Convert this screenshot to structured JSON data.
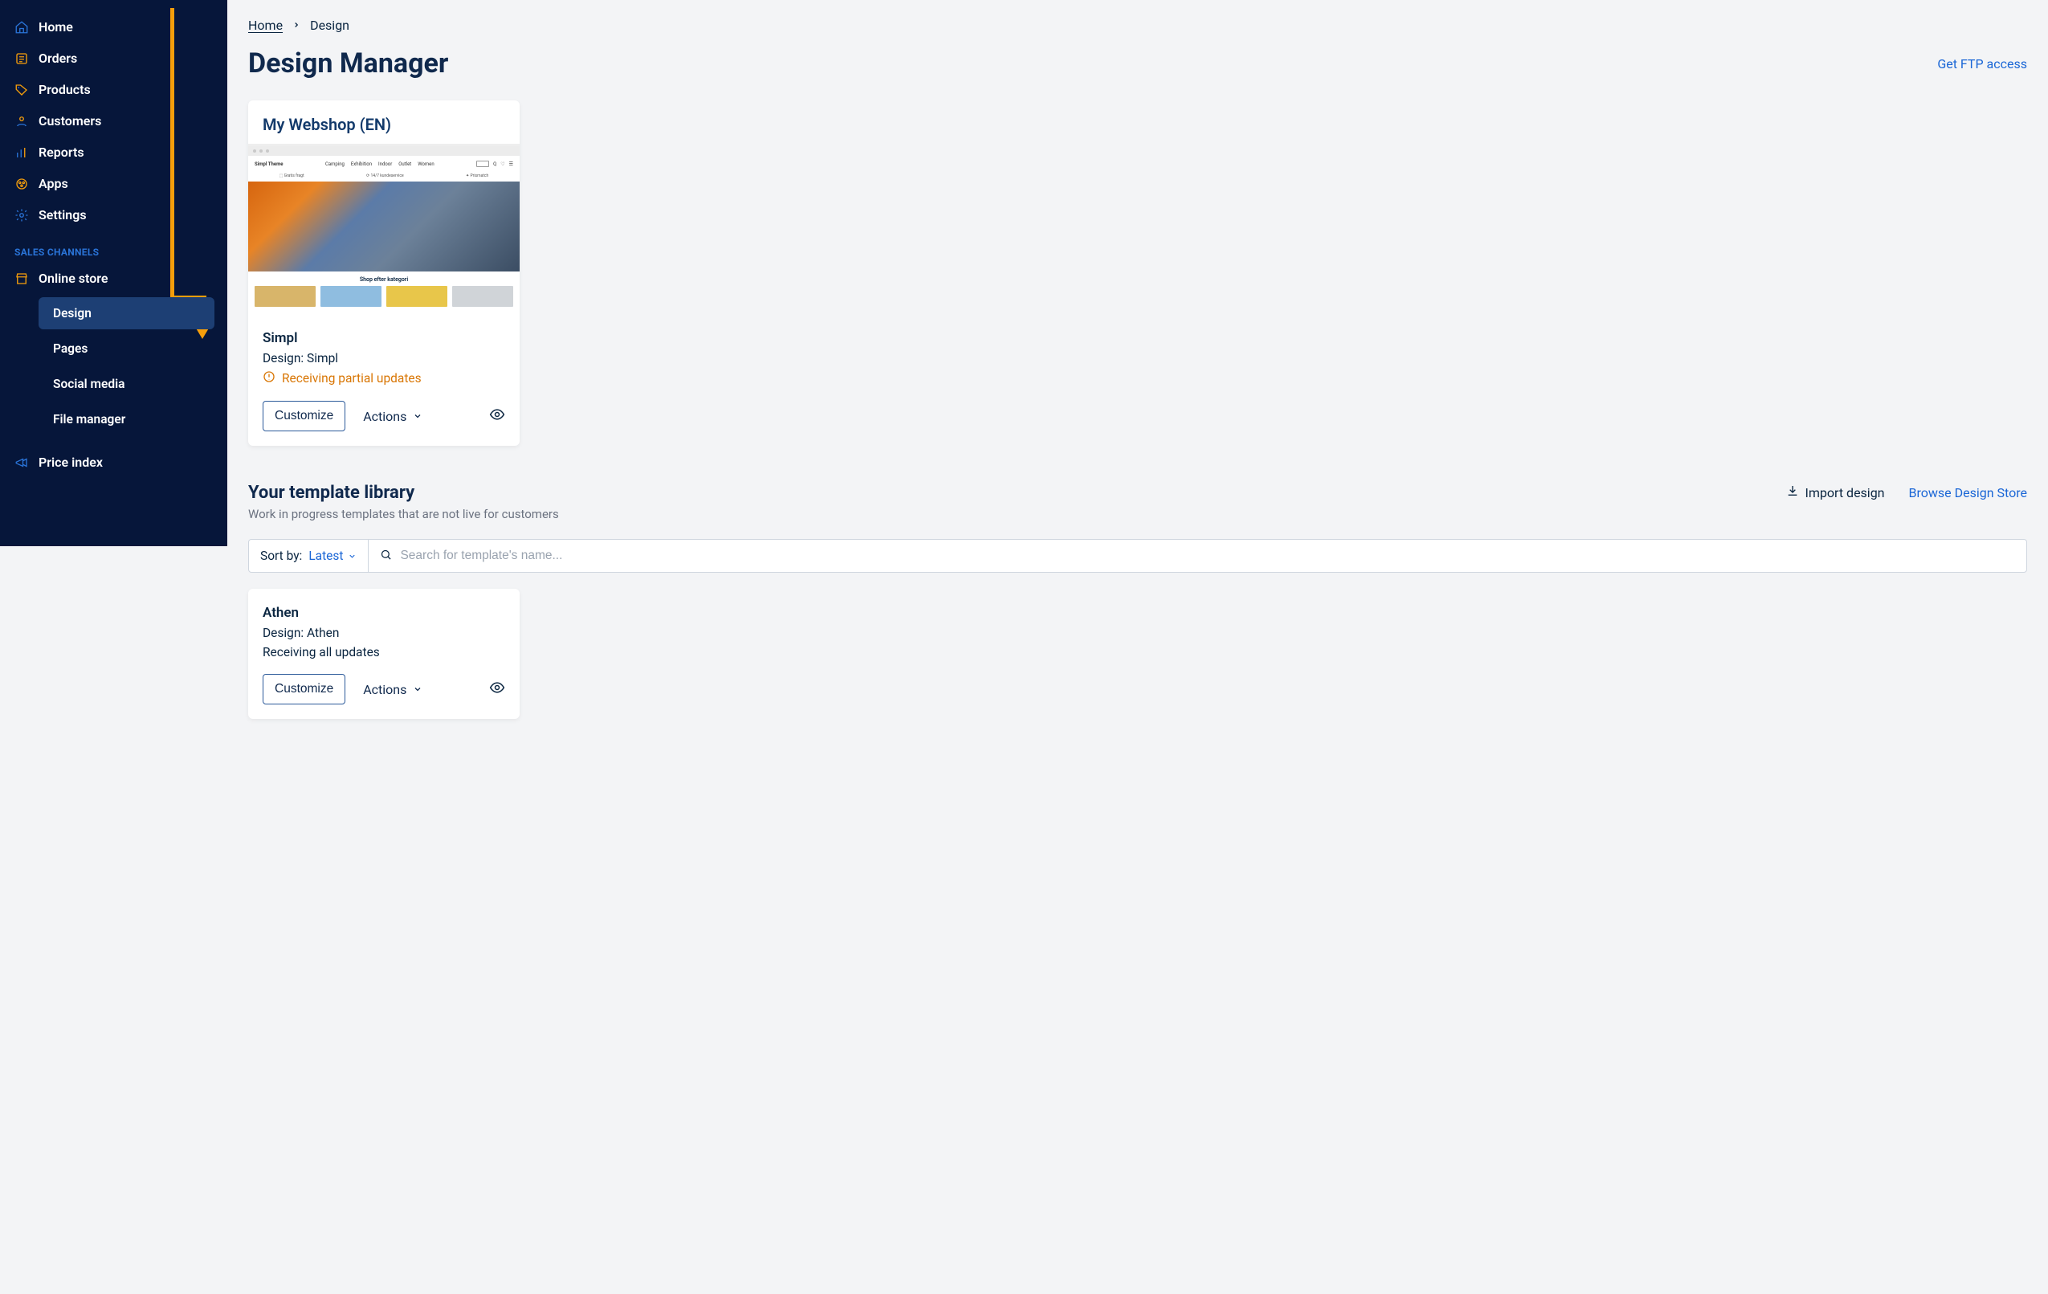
{
  "sidebar": {
    "items": [
      {
        "icon": "home",
        "label": "Home"
      },
      {
        "icon": "orders",
        "label": "Orders"
      },
      {
        "icon": "products",
        "label": "Products"
      },
      {
        "icon": "customers",
        "label": "Customers"
      },
      {
        "icon": "reports",
        "label": "Reports"
      },
      {
        "icon": "apps",
        "label": "Apps"
      },
      {
        "icon": "settings",
        "label": "Settings"
      }
    ],
    "section_label": "SALES CHANNELS",
    "channel": {
      "icon": "store",
      "label": "Online store"
    },
    "subitems": [
      "Design",
      "Pages",
      "Social media",
      "File manager"
    ],
    "active_sub": "Design",
    "price_index": {
      "label": "Price index"
    }
  },
  "breadcrumb": {
    "home": "Home",
    "current": "Design"
  },
  "page": {
    "title": "Design Manager",
    "ftp_link": "Get FTP access"
  },
  "active_theme": {
    "title": "My Webshop (EN)",
    "theme_name": "Simpl",
    "design_line": "Design: Simpl",
    "status": "Receiving partial updates",
    "customize_label": "Customize",
    "actions_label": "Actions",
    "preview_brand": "Simpl Theme",
    "preview_nav": [
      "Camping",
      "Exhibition",
      "Indoor",
      "Outlet",
      "Women"
    ],
    "preview_below": "Shop efter kategori"
  },
  "library": {
    "title": "Your template library",
    "subtitle": "Work in progress templates that are not live for customers",
    "import_label": "Import design",
    "browse_label": "Browse Design Store",
    "sort_label": "Sort by:",
    "sort_value": "Latest",
    "search_placeholder": "Search for template's name...",
    "items": [
      {
        "name": "Athen",
        "design_line": "Design: Athen",
        "status": "Receiving all updates",
        "customize_label": "Customize",
        "actions_label": "Actions"
      }
    ]
  }
}
